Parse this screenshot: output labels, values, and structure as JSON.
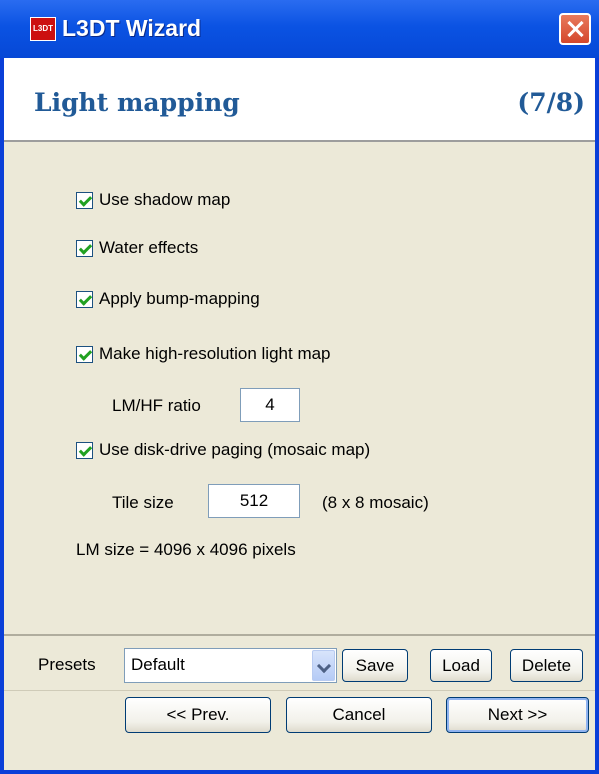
{
  "window": {
    "title": "L3DT Wizard",
    "app_icon_text": "L3DT"
  },
  "header": {
    "title": "Light mapping",
    "step": "(7/8)"
  },
  "options": {
    "shadow_map": "Use shadow map",
    "water_effects": "Water effects",
    "bump_mapping": "Apply bump-mapping",
    "high_res_lightmap": "Make high-resolution light map",
    "lm_hf_label": "LM/HF ratio",
    "lm_hf_value": "4",
    "disk_paging": "Use disk-drive paging (mosaic map)",
    "tile_size_label": "Tile size",
    "tile_size_value": "512",
    "mosaic_info": "(8 x 8 mosaic)",
    "lm_size_text": "LM size = 4096 x 4096 pixels"
  },
  "presets": {
    "label": "Presets",
    "selected": "Default",
    "save": "Save",
    "load": "Load",
    "delete": "Delete"
  },
  "nav": {
    "prev": "<< Prev.",
    "cancel": "Cancel",
    "next": "Next >>"
  },
  "colors": {
    "titlebar": "#0b53e3",
    "heading": "#215a97",
    "checkmark": "#21a121",
    "close": "#d4472c"
  }
}
